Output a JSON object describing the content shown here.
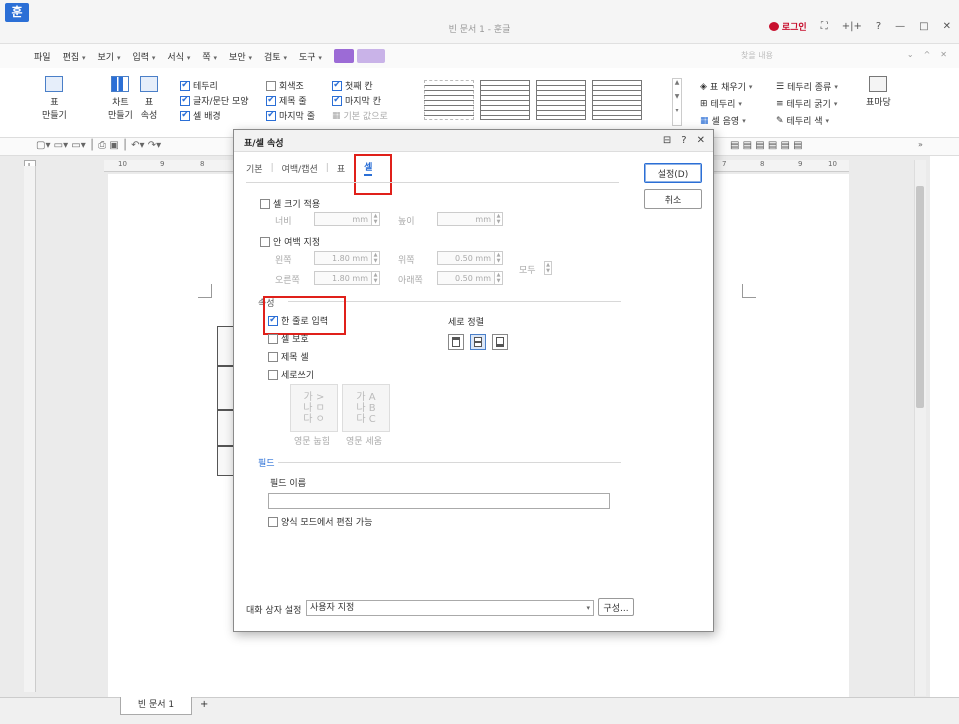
{
  "app": {
    "logo": "훈",
    "doc_title": "빈 문서 1 - 훈글",
    "login": "로그인",
    "title_icons": [
      "⛶",
      "+|+",
      "?",
      "—",
      "□",
      "✕"
    ]
  },
  "menu": {
    "items": [
      "파일",
      "편집",
      "보기",
      "입력",
      "서식",
      "쪽",
      "보안",
      "검토",
      "도구"
    ],
    "search_placeholder": "찾을 내용",
    "right_icons": [
      "⌄",
      "^",
      "✕"
    ]
  },
  "ribbon": {
    "table_btn": "표\n만들기",
    "chart_btn": "차트\n만들기",
    "props_btn": "표\n속성",
    "checks_col1": [
      {
        "label": "테두리",
        "checked": true
      },
      {
        "label": "글자/문단 모양",
        "checked": true
      },
      {
        "label": "셀 배경",
        "checked": true
      }
    ],
    "checks_col2": [
      {
        "label": "회색조",
        "checked": false
      },
      {
        "label": "제목 줄",
        "checked": true
      },
      {
        "label": "마지막 줄",
        "checked": true
      }
    ],
    "checks_col3": [
      {
        "label": "첫째 칸",
        "checked": true
      },
      {
        "label": "마지막 칸",
        "checked": true
      },
      {
        "label": "기본 값으로",
        "checked": false
      }
    ],
    "right_items": [
      [
        "표 채우기",
        "테두리 종류"
      ],
      [
        "테두리",
        "테두리 굵기"
      ],
      [
        "셀 음영",
        "테두리 색"
      ]
    ],
    "table_break": "표마당"
  },
  "ruler": {
    "ticks": [
      "10",
      "9",
      "8",
      "7",
      "8",
      "9",
      "10"
    ]
  },
  "doc_tab": {
    "label": "빈 문서 1",
    "add": "+"
  },
  "dialog": {
    "title": "표/셀 속성",
    "title_icons": [
      "⊟",
      "?",
      "✕"
    ],
    "tabs": [
      "기본",
      "여백/캡션",
      "표",
      "셀"
    ],
    "active_tab": "셀",
    "cell_size": {
      "label": "셀 크기 적용",
      "width_label": "너비",
      "width_val": "mm",
      "height_label": "높이",
      "height_val": "mm"
    },
    "inner_margin": {
      "label": "안 여백 지정",
      "left_label": "왼쪽",
      "left_val": "1.80  mm",
      "top_label": "위쪽",
      "top_val": "0.50  mm",
      "right_label": "오른쪽",
      "right_val": "1.80  mm",
      "bottom_label": "아래쪽",
      "bottom_val": "0.50  mm",
      "all_label": "모두"
    },
    "attr_section": "속성",
    "attrs": [
      {
        "label": "한 줄로 입력",
        "checked": true
      },
      {
        "label": "셀 보호",
        "checked": false
      },
      {
        "label": "제목 셀",
        "checked": false
      },
      {
        "label": "세로쓰기",
        "checked": false
      }
    ],
    "valign_label": "세로 정렬",
    "vert_dir": {
      "box1": "가 >\n나 ㅁ\n다 ㅇ",
      "box2": "가 A\n나 B\n다 C",
      "label1": "영문 눕힘",
      "label2": "영문 세움"
    },
    "field_section": "필드",
    "field_name_label": "필드 이름",
    "field_name_value": "",
    "form_edit_label": "양식 모드에서 편집 가능",
    "ok_button": "설정(D)",
    "cancel_button": "취소",
    "dlg_setting_label": "대화 상자 설정",
    "dlg_setting_value": "사용자 지정",
    "config_button": "구성..."
  },
  "colors": {
    "accent": "#2b6fd6",
    "highlight": "#e0201a"
  }
}
